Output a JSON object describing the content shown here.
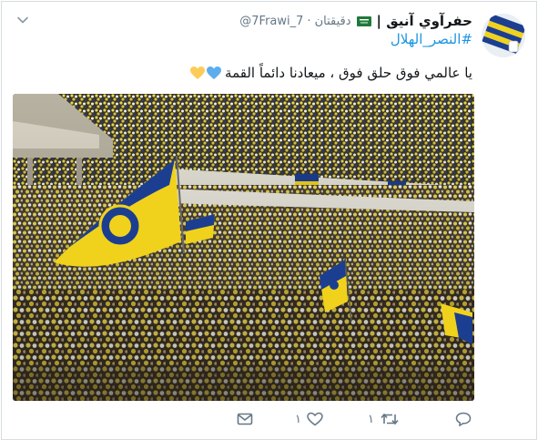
{
  "tweet": {
    "display_name": "حفرآوي آنيق |",
    "handle": "@7Frawi_7",
    "separator": "·",
    "time": "دقيقتان",
    "hashtag": "#النصر_الهلال",
    "text": "يا عالمي فوق حلق فوق ، ميعادنا دائماً القمة",
    "emoji_hearts": [
      "blue-heart",
      "yellow-heart"
    ]
  },
  "actions": {
    "reply_count": "",
    "retweet_count": "١",
    "like_count": "١",
    "message_count": ""
  },
  "colors": {
    "link": "#1b95e0",
    "muted": "#657786",
    "text": "#14171a",
    "border": "#d8dde1",
    "club_yellow": "#f0d21c",
    "club_blue": "#1c3e91"
  },
  "icons": {
    "caret": "chevron-down-icon",
    "flag": "saudi-flag-icon",
    "reply": "reply-icon",
    "retweet": "retweet-icon",
    "like": "heart-icon",
    "message": "envelope-icon"
  }
}
